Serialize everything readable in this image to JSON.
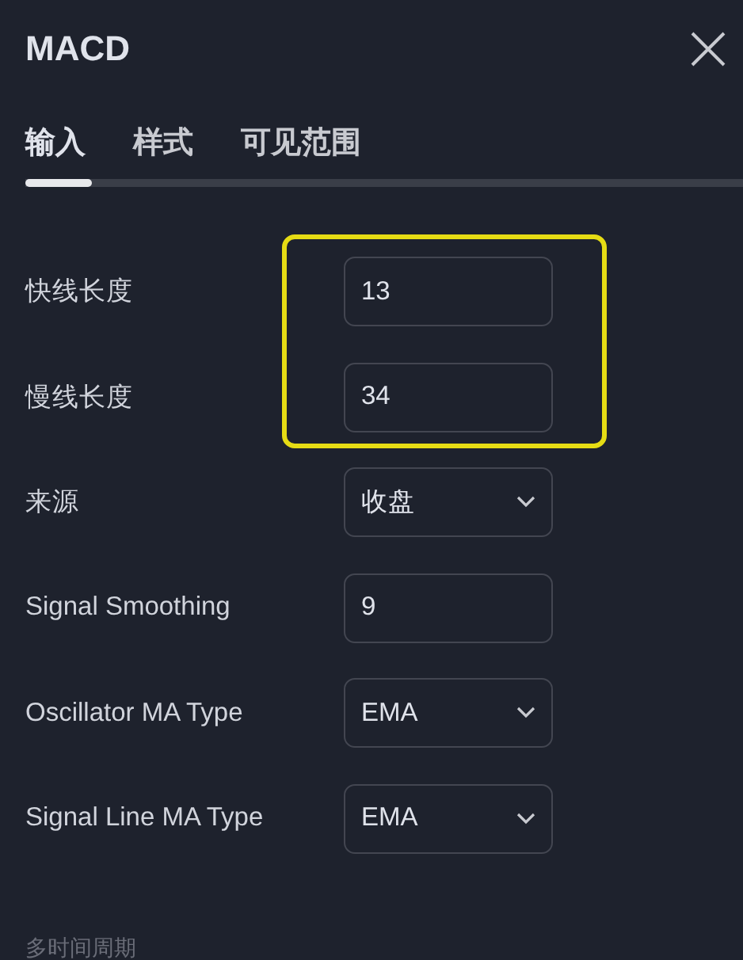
{
  "title": "MACD",
  "tabs": [
    {
      "label": "输入",
      "selected": true
    },
    {
      "label": "样式",
      "selected": false
    },
    {
      "label": "可见范围",
      "selected": false
    }
  ],
  "fields": [
    {
      "label": "快线长度",
      "kind": "number",
      "value": "13",
      "highlighted": true
    },
    {
      "label": "慢线长度",
      "kind": "number",
      "value": "34",
      "highlighted": true
    },
    {
      "label": "来源",
      "kind": "select",
      "value": "收盘",
      "highlighted": false
    },
    {
      "label": "Signal Smoothing",
      "kind": "number",
      "value": "9",
      "highlighted": false
    },
    {
      "label": "Oscillator MA Type",
      "kind": "select",
      "value": "EMA",
      "highlighted": false
    },
    {
      "label": "Signal Line MA Type",
      "kind": "select",
      "value": "EMA",
      "highlighted": false
    }
  ],
  "section_heading": "多时间周期"
}
